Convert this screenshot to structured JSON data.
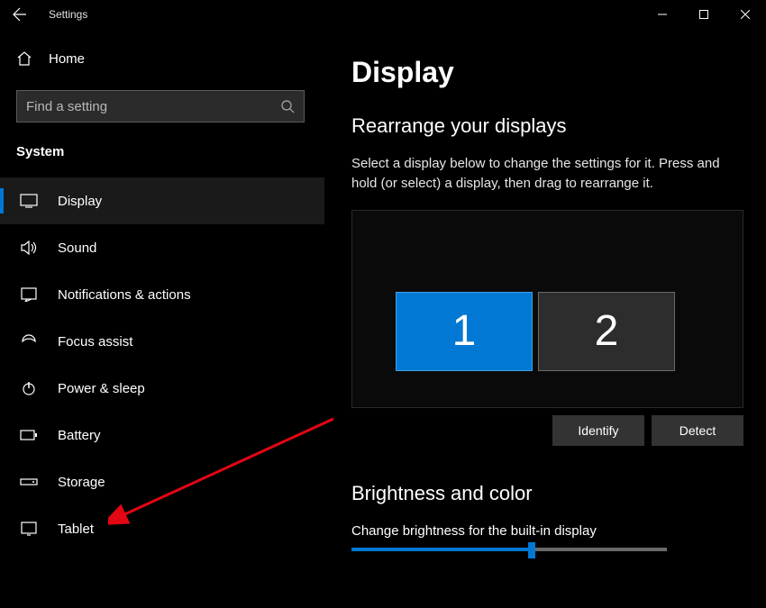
{
  "titlebar": {
    "title": "Settings"
  },
  "sidebar": {
    "home_label": "Home",
    "search_placeholder": "Find a setting",
    "section_label": "System",
    "items": [
      {
        "label": "Display"
      },
      {
        "label": "Sound"
      },
      {
        "label": "Notifications & actions"
      },
      {
        "label": "Focus assist"
      },
      {
        "label": "Power & sleep"
      },
      {
        "label": "Battery"
      },
      {
        "label": "Storage"
      },
      {
        "label": "Tablet"
      }
    ]
  },
  "main": {
    "heading": "Display",
    "rearrange_heading": "Rearrange your displays",
    "rearrange_desc": "Select a display below to change the settings for it. Press and hold (or select) a display, then drag to rearrange it.",
    "monitor1": "1",
    "monitor2": "2",
    "identify_label": "Identify",
    "detect_label": "Detect",
    "brightness_heading": "Brightness and color",
    "brightness_label": "Change brightness for the built-in display"
  }
}
